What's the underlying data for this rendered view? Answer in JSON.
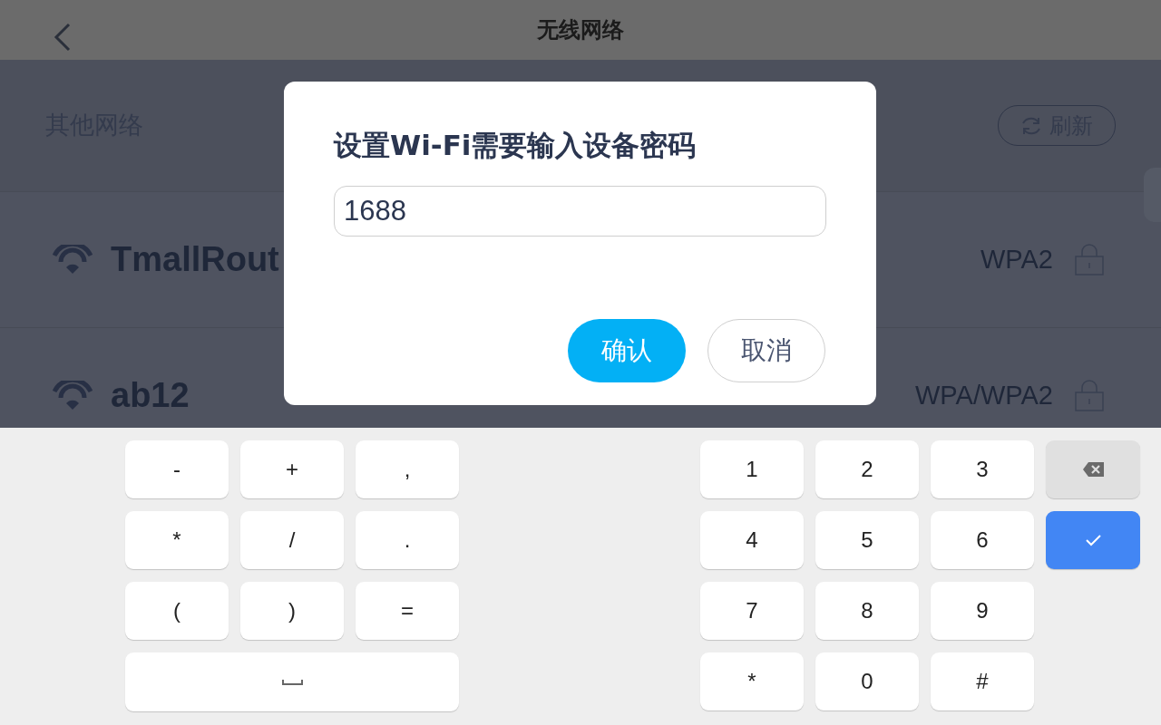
{
  "header": {
    "title": "无线网络"
  },
  "section": {
    "title": "其他网络",
    "refresh_button": "刷新"
  },
  "networks": [
    {
      "name": "TmallRout",
      "security": "WPA2"
    },
    {
      "name": "ab12",
      "security": "WPA/WPA2"
    }
  ],
  "dialog": {
    "title": "设置Wi-Fi需要输入设备密码",
    "input_value": "1688",
    "buttons": [
      {
        "label": "确认",
        "kind": "primary"
      },
      {
        "label": "取消",
        "kind": "secondary"
      }
    ]
  },
  "keyboard": {
    "symbol_keys": [
      {
        "kind": "char",
        "label": "-"
      },
      {
        "kind": "char",
        "label": "+"
      },
      {
        "kind": "char",
        "label": ","
      },
      {
        "kind": "char",
        "label": "*"
      },
      {
        "kind": "char",
        "label": "/"
      },
      {
        "kind": "char",
        "label": "."
      },
      {
        "kind": "char",
        "label": "("
      },
      {
        "kind": "char",
        "label": ")"
      },
      {
        "kind": "char",
        "label": "="
      },
      {
        "kind": "space"
      }
    ],
    "number_keys": [
      "1",
      "2",
      "3",
      "4",
      "5",
      "6",
      "7",
      "8",
      "9",
      "*",
      "0",
      "#"
    ],
    "action_keys": [
      {
        "kind": "backspace"
      },
      {
        "kind": "enter"
      }
    ]
  }
}
